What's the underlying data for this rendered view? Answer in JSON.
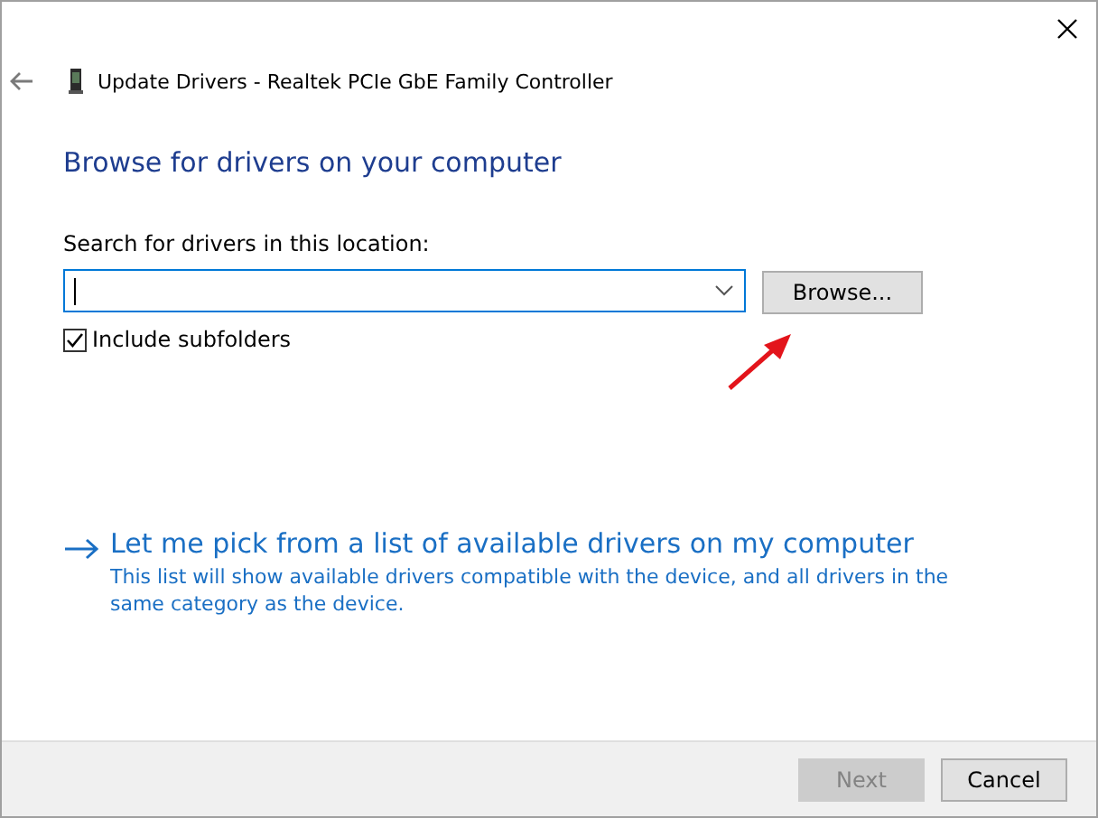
{
  "window": {
    "title": "Update Drivers - Realtek PCIe GbE Family Controller"
  },
  "heading": "Browse for drivers on your computer",
  "location": {
    "label": "Search for drivers in this location:",
    "focused": true,
    "browse_button": "Browse..."
  },
  "include_subfolders": {
    "label": "Include subfolders",
    "checked": true
  },
  "pick_option": {
    "title": "Let me pick from a list of available drivers on my computer",
    "description": "This list will show available drivers compatible with the device, and all drivers in the same category as the device."
  },
  "buttons": [
    {
      "label": "Next",
      "disabled": true
    },
    {
      "label": "Cancel",
      "disabled": false
    }
  ]
}
